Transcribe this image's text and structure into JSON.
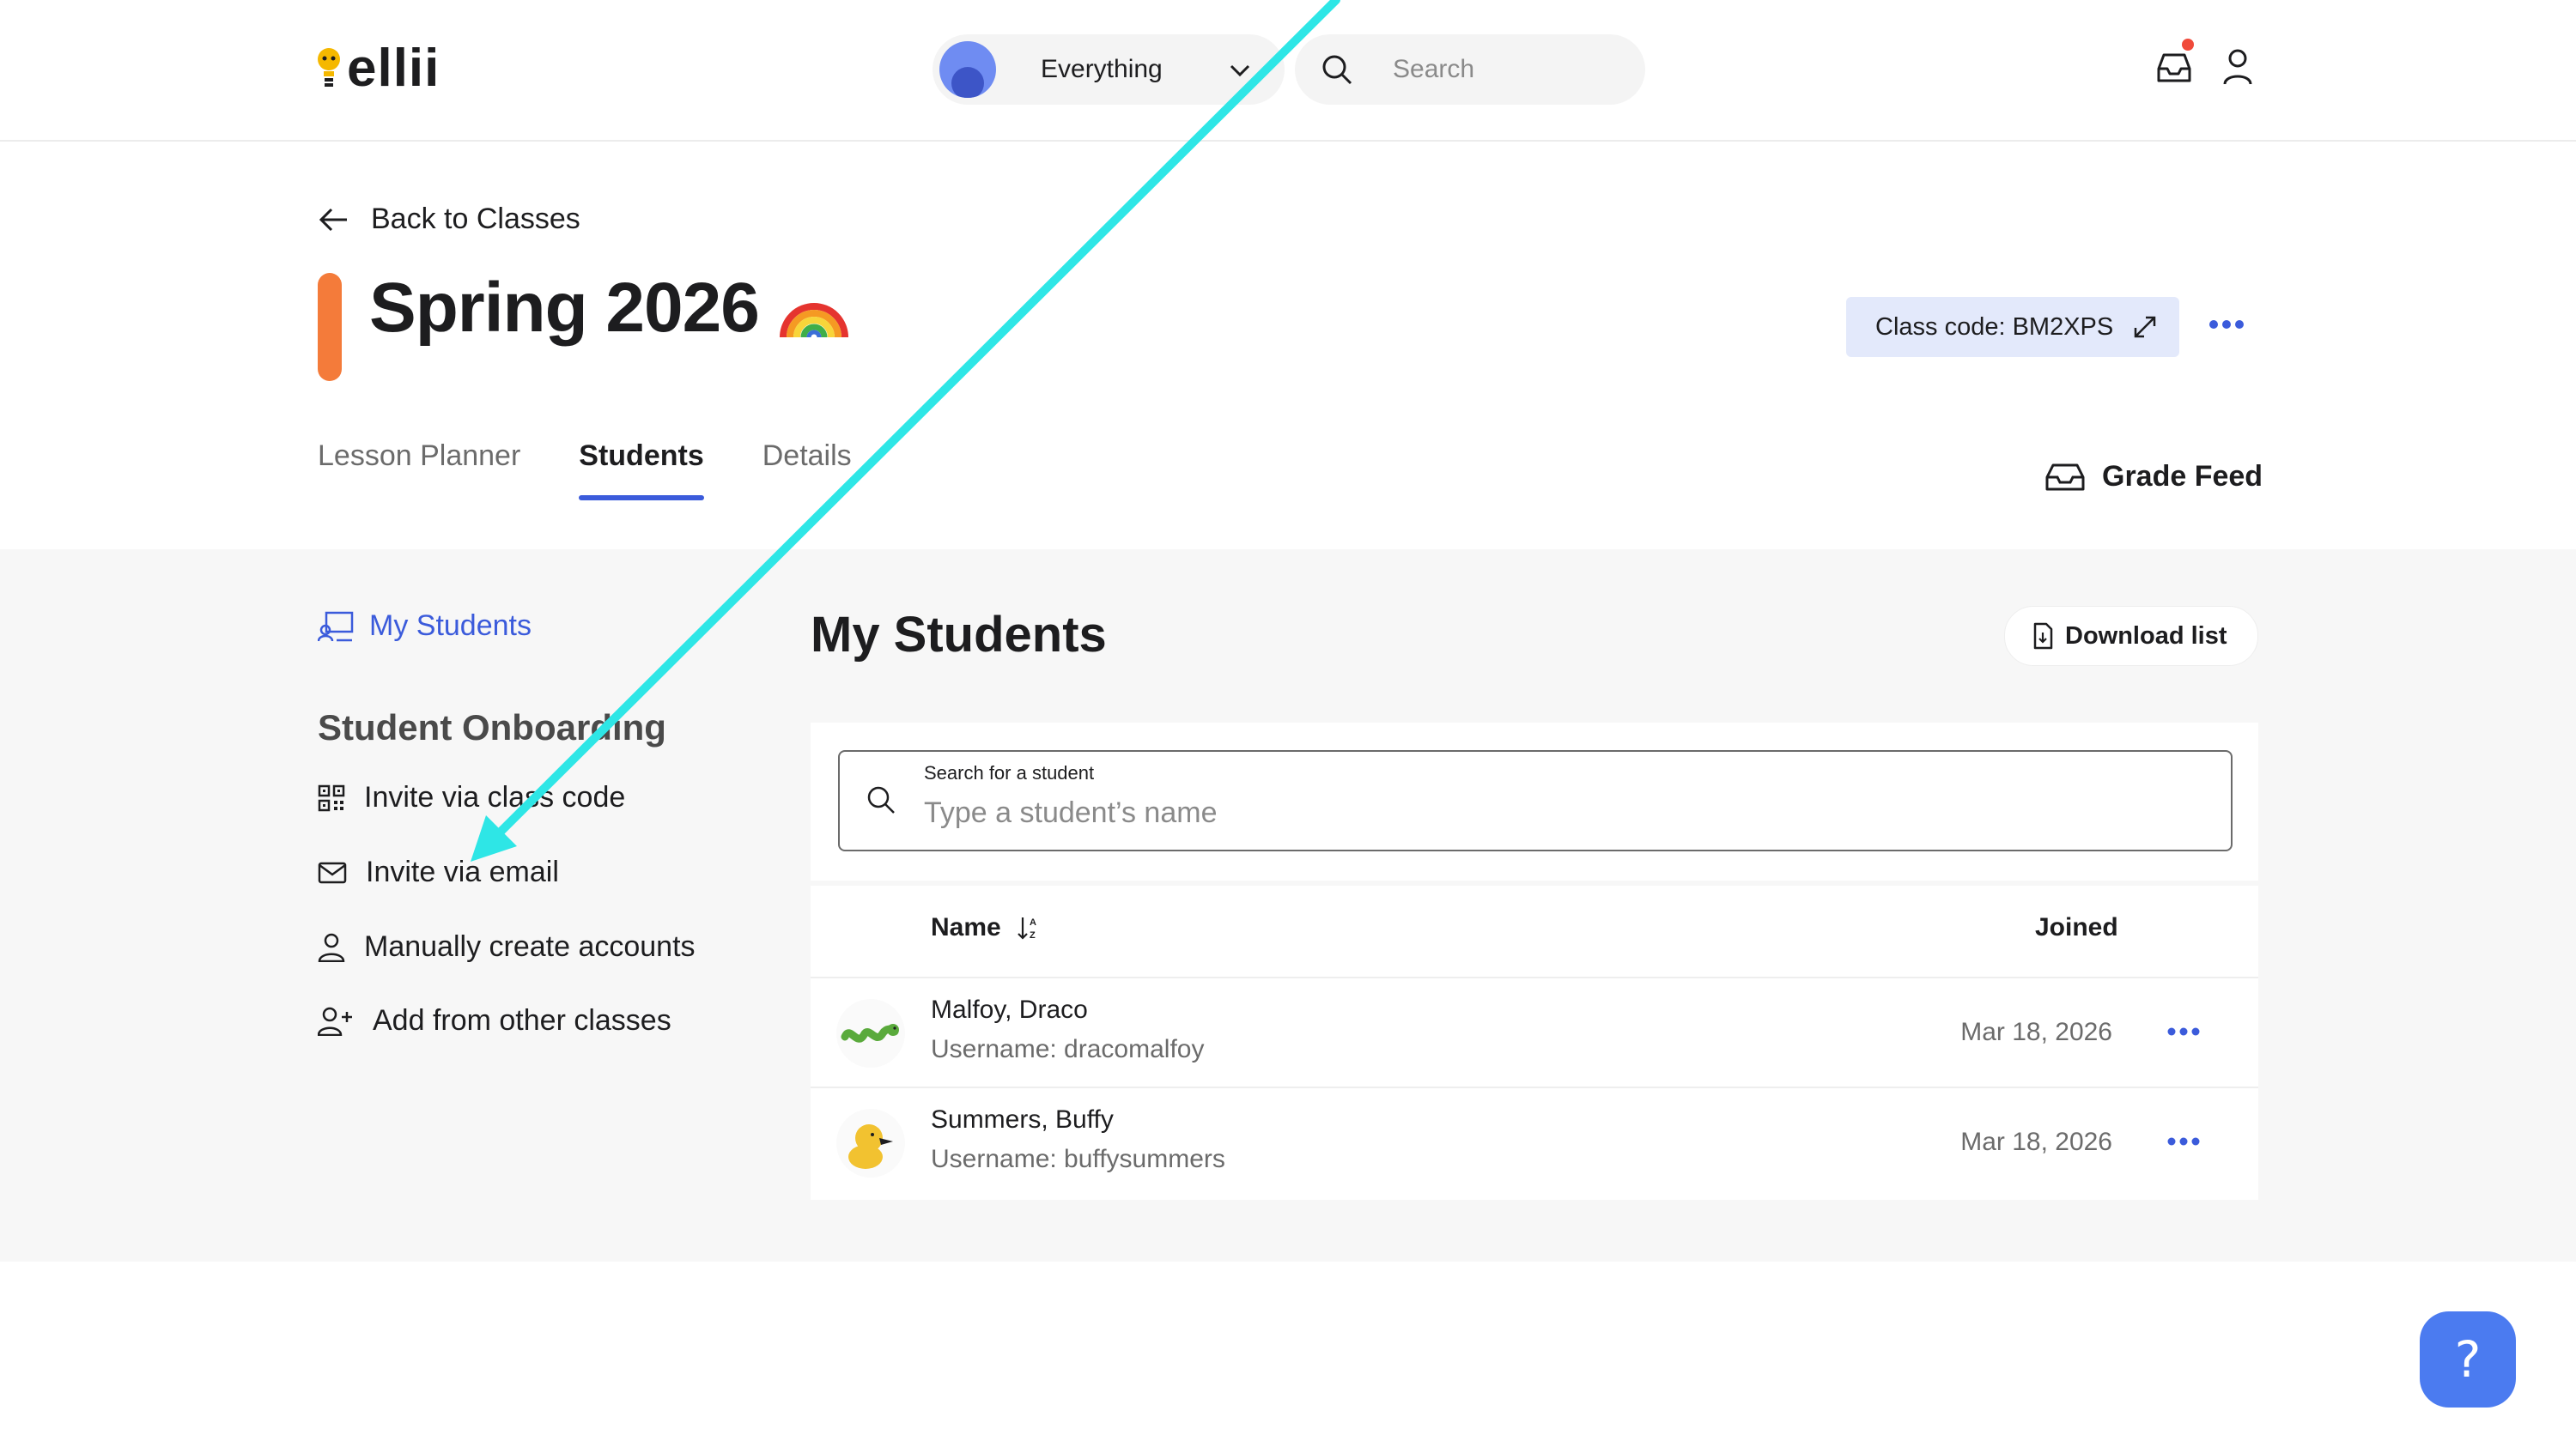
{
  "nav": {
    "logo_text": "ellii",
    "scope_label": "Everything",
    "search_placeholder": "Search",
    "icons": [
      "inbox-icon",
      "user-icon",
      "search-icon",
      "chevron-down-icon"
    ]
  },
  "header": {
    "back_label": "Back to Classes",
    "class_title": "Spring 2026",
    "class_code_label": "Class code: BM2XPS",
    "accent_color": "#f47b3a",
    "tabs": [
      {
        "label": "Lesson Planner",
        "active": false
      },
      {
        "label": "Students",
        "active": true
      },
      {
        "label": "Details",
        "active": false
      }
    ],
    "grade_feed_label": "Grade Feed"
  },
  "sidebar": {
    "my_students_label": "My Students",
    "onboarding_title": "Student Onboarding",
    "items": [
      {
        "label": "Invite via class code",
        "icon": "qr-code-icon"
      },
      {
        "label": "Invite via email",
        "icon": "mail-icon"
      },
      {
        "label": "Manually create accounts",
        "icon": "person-icon"
      },
      {
        "label": "Add from other classes",
        "icon": "person-add-icon"
      }
    ]
  },
  "main": {
    "title": "My Students",
    "download_label": "Download list",
    "search_label": "Search for a student",
    "search_placeholder": "Type a student’s name",
    "columns": {
      "name": "Name",
      "joined": "Joined"
    },
    "students": [
      {
        "name": "Malfoy, Draco",
        "username": "Username: dracomalfoy",
        "joined": "Mar 18, 2026",
        "avatar": "snake-avatar"
      },
      {
        "name": "Summers, Buffy",
        "username": "Username: buffysummers",
        "joined": "Mar 18, 2026",
        "avatar": "duck-avatar"
      }
    ]
  },
  "colors": {
    "primary": "#3b5bdb",
    "annotation_arrow": "#2ee6e6",
    "help_button": "#4b7bf0"
  }
}
